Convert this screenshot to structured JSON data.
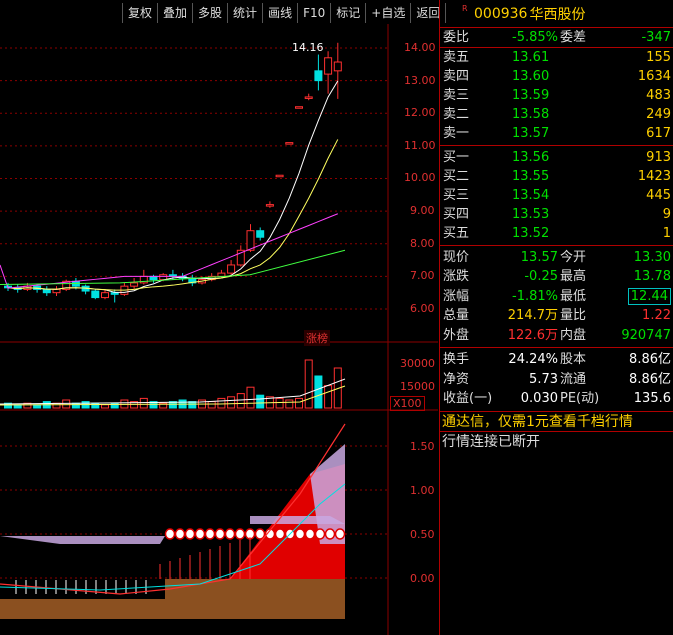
{
  "toolbar": [
    "复权",
    "叠加",
    "多股",
    "统计",
    "画线",
    "F10",
    "标记",
    "+自选",
    "返回"
  ],
  "stock": {
    "flag": "R",
    "code": "000936",
    "name": "华西股份"
  },
  "weibi": {
    "label": "委比",
    "value": "-5.85%",
    "label2": "委差",
    "value2": "-347"
  },
  "asks": [
    {
      "label": "卖五",
      "price": "13.61",
      "vol": "155"
    },
    {
      "label": "卖四",
      "price": "13.60",
      "vol": "1634"
    },
    {
      "label": "卖三",
      "price": "13.59",
      "vol": "483"
    },
    {
      "label": "卖二",
      "price": "13.58",
      "vol": "249"
    },
    {
      "label": "卖一",
      "price": "13.57",
      "vol": "617"
    }
  ],
  "bids": [
    {
      "label": "买一",
      "price": "13.56",
      "vol": "913"
    },
    {
      "label": "买二",
      "price": "13.55",
      "vol": "1423"
    },
    {
      "label": "买三",
      "price": "13.54",
      "vol": "445"
    },
    {
      "label": "买四",
      "price": "13.53",
      "vol": "9"
    },
    {
      "label": "买五",
      "price": "13.52",
      "vol": "1"
    }
  ],
  "quote": {
    "xianjia": {
      "label": "现价",
      "value": "13.57",
      "label2": "今开",
      "value2": "13.30"
    },
    "zhangdie": {
      "label": "涨跌",
      "value": "-0.25",
      "label2": "最高",
      "value2": "13.78"
    },
    "zhangfu": {
      "label": "涨幅",
      "value": "-1.81%",
      "label2": "最低",
      "value2": "12.44"
    },
    "zongliang": {
      "label": "总量",
      "value": "214.7万",
      "label2": "量比",
      "value2": "1.22"
    },
    "waipan": {
      "label": "外盘",
      "value": "122.6万",
      "label2": "内盘",
      "value2": "920747"
    }
  },
  "stats": {
    "huanshou": {
      "label": "换手",
      "value": "24.24%",
      "label2": "股本",
      "value2": "8.86亿"
    },
    "jingzi": {
      "label": "净资",
      "value": "5.73",
      "label2": "流通",
      "value2": "8.86亿"
    },
    "shouyi": {
      "label": "收益(一)",
      "value": "0.030",
      "label2": "PE(动)",
      "value2": "135.6"
    }
  },
  "ad_text": "通达信，仅需1元查看千档行情",
  "status_text": "行情连接已断开",
  "chart": {
    "price_axis": [
      "14.00",
      "13.00",
      "12.00",
      "11.00",
      "10.00",
      "9.00",
      "8.00",
      "7.00",
      "6.00"
    ],
    "high_label": "14.16",
    "zhangbang_label": "涨榜",
    "vol_axis": [
      "30000",
      "15000"
    ],
    "vol_unit": "X100",
    "ind_axis": [
      "1.50",
      "1.00",
      "0.50",
      "0.00"
    ],
    "colors": {
      "up": "#ff3030",
      "down": "#00e0e0",
      "ma5": "#ffffff",
      "ma10": "#ffff60",
      "ma20": "#ff40ff",
      "ma60": "#40ff40",
      "grid": "#8b0000"
    }
  }
}
